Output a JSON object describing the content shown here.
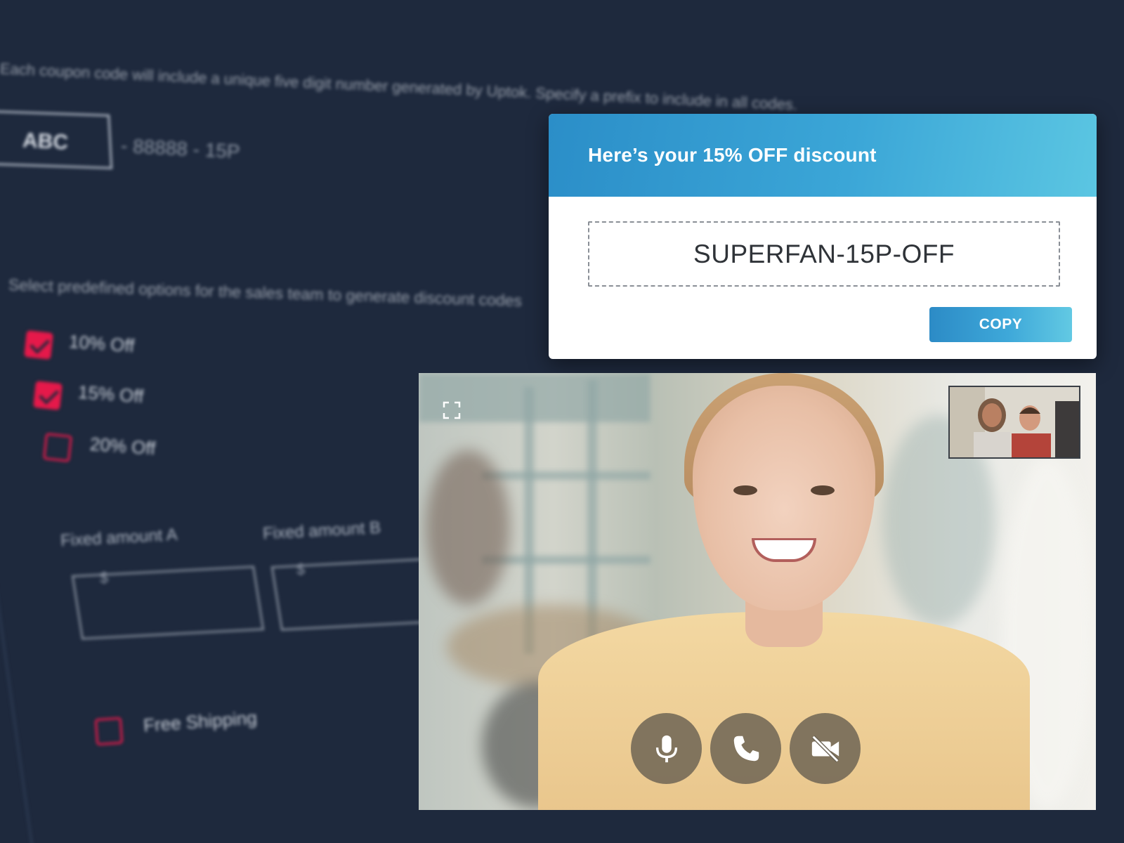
{
  "background_form": {
    "code_description": "Each coupon code will include a unique five digit number generated by Uptok. Specify a prefix to include in all codes.",
    "prefix_value": "ABC",
    "code_suffix": "- 88888 - 15P",
    "options_description": "Select predefined options for the sales team to generate discount codes",
    "options": [
      {
        "label": "10% Off",
        "checked": true
      },
      {
        "label": "15% Off",
        "checked": true
      },
      {
        "label": "20% Off",
        "checked": false
      }
    ],
    "fixed_amount_a_label": "Fixed amount A",
    "fixed_amount_b_label": "Fixed amount B",
    "currency_symbol": "$",
    "free_shipping_label": "Free Shipping",
    "free_shipping_checked": false,
    "accent_color": "#e5194a"
  },
  "discount_popup": {
    "title": "Here’s your 15% OFF discount",
    "coupon_code": "SUPERFAN-15P-OFF",
    "copy_label": "COPY",
    "header_color": "#3ba6d7"
  },
  "video_call": {
    "controls": [
      {
        "name": "microphone",
        "icon": "microphone-icon"
      },
      {
        "name": "call",
        "icon": "phone-icon"
      },
      {
        "name": "camera",
        "icon": "video-off-icon"
      }
    ],
    "fullscreen_icon": "fullscreen-icon"
  }
}
